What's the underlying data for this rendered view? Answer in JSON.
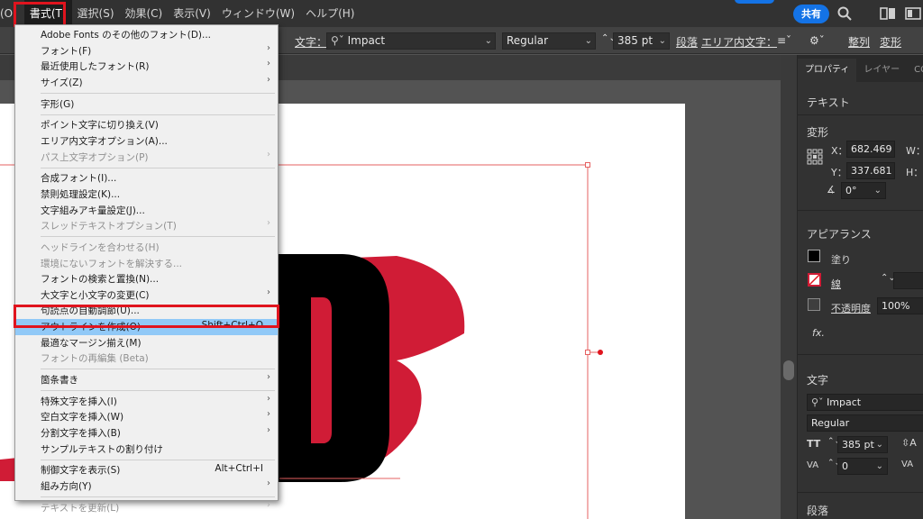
{
  "menubar": {
    "items": [
      "(O)",
      "書式(T)",
      "選択(S)",
      "効果(C)",
      "表示(V)",
      "ウィンドウ(W)",
      "ヘルプ(H)"
    ],
    "active_index": 1,
    "share_label": "共有",
    "icons": [
      "search-icon",
      "arrange-documents-icon",
      "workspace-icon"
    ]
  },
  "control_bar": {
    "text_label": "文字：",
    "font_name": "Impact",
    "font_style": "Regular",
    "font_size": "385 pt",
    "paragraph_label": "段落",
    "area_text_label": "エリア内文字：",
    "align_label": "整列",
    "transform_label": "変形"
  },
  "type_menu": {
    "items": [
      {
        "label": "Adobe Fonts のその他のフォント(D)...",
        "shortcut": "",
        "submenu": false,
        "disabled": false
      },
      {
        "label": "フォント(F)",
        "shortcut": "",
        "submenu": true,
        "disabled": false
      },
      {
        "label": "最近使用したフォント(R)",
        "shortcut": "",
        "submenu": true,
        "disabled": false
      },
      {
        "label": "サイズ(Z)",
        "shortcut": "",
        "submenu": true,
        "disabled": false,
        "sep_after": true
      },
      {
        "label": "字形(G)",
        "shortcut": "",
        "submenu": false,
        "disabled": false,
        "sep_after": true
      },
      {
        "label": "ポイント文字に切り換え(V)",
        "shortcut": "",
        "submenu": false,
        "disabled": false
      },
      {
        "label": "エリア内文字オプション(A)...",
        "shortcut": "",
        "submenu": false,
        "disabled": false
      },
      {
        "label": "パス上文字オプション(P)",
        "shortcut": "",
        "submenu": true,
        "disabled": true,
        "sep_after": true
      },
      {
        "label": "合成フォント(I)...",
        "shortcut": "",
        "submenu": false,
        "disabled": false
      },
      {
        "label": "禁則処理設定(K)...",
        "shortcut": "",
        "submenu": false,
        "disabled": false
      },
      {
        "label": "文字組みアキ量設定(J)...",
        "shortcut": "",
        "submenu": false,
        "disabled": false
      },
      {
        "label": "スレッドテキストオプション(T)",
        "shortcut": "",
        "submenu": true,
        "disabled": true,
        "sep_after": true
      },
      {
        "label": "ヘッドラインを合わせる(H)",
        "shortcut": "",
        "submenu": false,
        "disabled": true
      },
      {
        "label": "環境にないフォントを解決する...",
        "shortcut": "",
        "submenu": false,
        "disabled": true
      },
      {
        "label": "フォントの検索と置換(N)...",
        "shortcut": "",
        "submenu": false,
        "disabled": false
      },
      {
        "label": "大文字と小文字の変更(C)",
        "shortcut": "",
        "submenu": true,
        "disabled": false
      },
      {
        "label": "句読点の自動調節(U)...",
        "shortcut": "",
        "submenu": false,
        "disabled": false
      },
      {
        "label": "アウトラインを作成(O)",
        "shortcut": "Shift+Ctrl+O",
        "submenu": false,
        "disabled": false,
        "selected": true
      },
      {
        "label": "最適なマージン揃え(M)",
        "shortcut": "",
        "submenu": false,
        "disabled": false
      },
      {
        "label": "フォントの再編集 (Beta)",
        "shortcut": "",
        "submenu": false,
        "disabled": true,
        "sep_after": true
      },
      {
        "label": "箇条書き",
        "shortcut": "",
        "submenu": true,
        "disabled": false,
        "sep_after": true
      },
      {
        "label": "特殊文字を挿入(I)",
        "shortcut": "",
        "submenu": true,
        "disabled": false
      },
      {
        "label": "空白文字を挿入(W)",
        "shortcut": "",
        "submenu": true,
        "disabled": false
      },
      {
        "label": "分割文字を挿入(B)",
        "shortcut": "",
        "submenu": true,
        "disabled": false
      },
      {
        "label": "サンプルテキストの割り付け",
        "shortcut": "",
        "submenu": false,
        "disabled": false,
        "sep_after": true
      },
      {
        "label": "制御文字を表示(S)",
        "shortcut": "Alt+Ctrl+I",
        "submenu": false,
        "disabled": false
      },
      {
        "label": "組み方向(Y)",
        "shortcut": "",
        "submenu": true,
        "disabled": false,
        "sep_after": true
      },
      {
        "label": "テキストを更新(L)",
        "shortcut": "",
        "submenu": true,
        "disabled": true
      }
    ]
  },
  "properties_panel": {
    "tabs": [
      "プロパティ",
      "レイヤー",
      "CC ラ"
    ],
    "section_text": "テキスト",
    "transform_head": "変形",
    "x_label": "X：",
    "x_value": "682.469",
    "y_label": "Y：",
    "y_value": "337.681",
    "w_label": "W：",
    "h_label": "H：",
    "rotation_value": "0°",
    "appearance_head": "アピアランス",
    "fill_label": "塗り",
    "stroke_label": "線",
    "opacity_label": "不透明度",
    "opacity_value": "100%",
    "character_head": "文字",
    "font_name": "Impact",
    "font_style": "Regular",
    "font_size": "385 pt",
    "tracking_value": "0",
    "paragraph_head": "段落"
  },
  "colors": {
    "accent_red": "#d01c36",
    "highlight": "#e0141e",
    "selection_blue": "#91c9f7",
    "share_blue": "#1473e6"
  }
}
